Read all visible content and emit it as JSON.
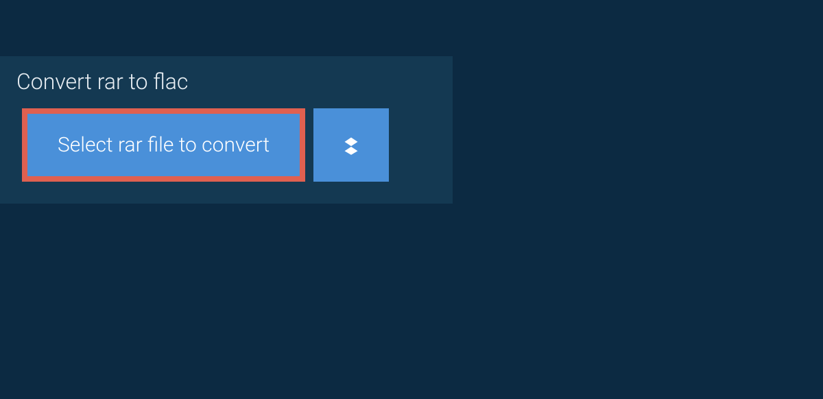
{
  "tab": {
    "label": "Convert rar to flac"
  },
  "buttons": {
    "select_file_label": "Select rar file to convert"
  }
}
